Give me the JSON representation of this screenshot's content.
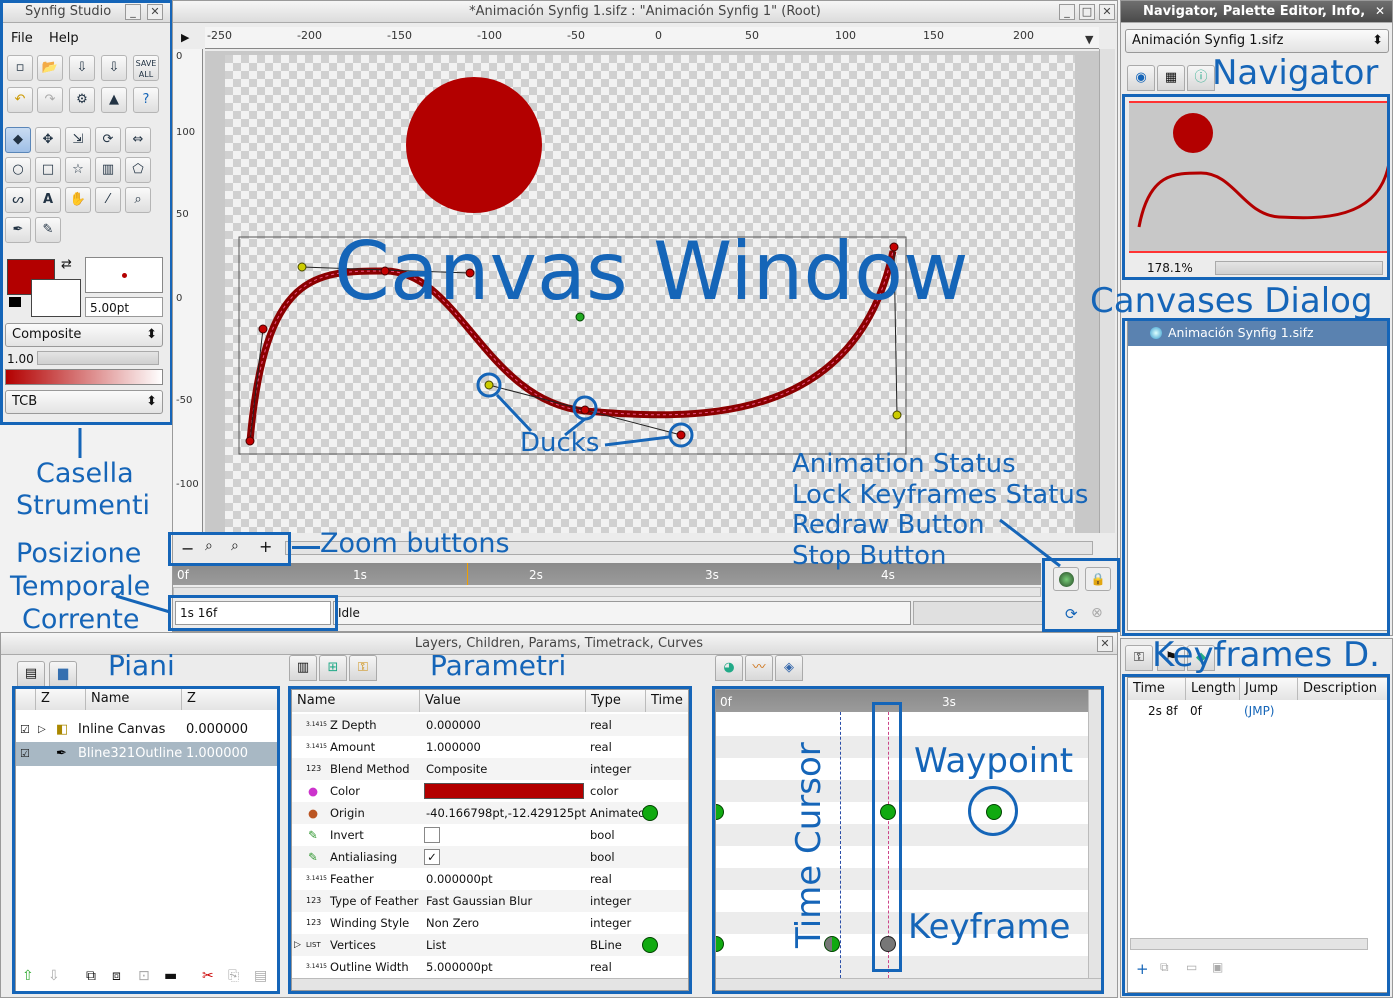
{
  "toolbox": {
    "title": "Synfig Studio",
    "menu": [
      "File",
      "Help"
    ],
    "outline_width": "5.00pt",
    "blend": "Composite",
    "opacity": "1.00",
    "interpolation": "TCB",
    "save_all": "SAVE ALL"
  },
  "canvas": {
    "title": "*Animación Synfig 1.sifz : \"Animación Synfig 1\" (Root)",
    "hruler": [
      "-250",
      "-200",
      "-150",
      "-100",
      "-50",
      "0",
      "50",
      "100",
      "150",
      "200"
    ],
    "vruler": [
      "0",
      "100",
      "50",
      "0",
      "-50",
      "-100"
    ],
    "timeline": [
      "0f",
      "1s",
      "2s",
      "3s",
      "4s"
    ],
    "current_time": "1s 16f",
    "status": "Idle"
  },
  "navigator": {
    "title": "Navigator, Palette Editor, Info,",
    "file": "Animación Synfig 1.sifz",
    "zoom": "178.1%"
  },
  "canvases": {
    "item": "Animación Synfig 1.sifz"
  },
  "keyframes": {
    "headers": [
      "Time",
      "Length",
      "Jump",
      "Description"
    ],
    "rows": [
      {
        "time": "2s 8f",
        "length": "0f",
        "jump": "(JMP)",
        "desc": ""
      }
    ]
  },
  "bottom": {
    "title": "Layers, Children, Params, Timetrack, Curves"
  },
  "layers": {
    "headers": [
      "Z",
      "Name",
      "Z"
    ],
    "rows": [
      {
        "name": "Inline Canvas",
        "z": "0.000000"
      },
      {
        "name": "Bline321Outline",
        "z": "1.000000"
      }
    ]
  },
  "params": {
    "headers": [
      "Name",
      "Value",
      "Type",
      "Time"
    ],
    "rows": [
      {
        "icon": "3.1415",
        "name": "Z Depth",
        "value": "0.000000",
        "type": "real"
      },
      {
        "icon": "3.1415",
        "name": "Amount",
        "value": "1.000000",
        "type": "real"
      },
      {
        "icon": "123",
        "name": "Blend Method",
        "value": "Composite",
        "type": "integer"
      },
      {
        "icon": "●",
        "name": "Color",
        "value": "",
        "type": "color"
      },
      {
        "icon": "●",
        "name": "Origin",
        "value": "-40.166798pt,-12.429125pt",
        "type": "Animated"
      },
      {
        "icon": "✎",
        "name": "Invert",
        "value": "",
        "type": "bool"
      },
      {
        "icon": "✎",
        "name": "Antialiasing",
        "value": "✓",
        "type": "bool"
      },
      {
        "icon": "3.1415",
        "name": "Feather",
        "value": "0.000000pt",
        "type": "real"
      },
      {
        "icon": "123",
        "name": "Type of Feather",
        "value": "Fast Gaussian Blur",
        "type": "integer"
      },
      {
        "icon": "123",
        "name": "Winding Style",
        "value": "Non Zero",
        "type": "integer"
      },
      {
        "icon": "LIST",
        "name": "Vertices",
        "value": "List",
        "type": "BLine"
      },
      {
        "icon": "3.1415",
        "name": "Outline Width",
        "value": "5.000000pt",
        "type": "real"
      }
    ]
  },
  "timetrack": {
    "labels": [
      "0f",
      "3s"
    ]
  },
  "annotations": {
    "canvas_window": "Canvas Window",
    "navigator": "Navigator",
    "canvases_dialog": "Canvases Dialog",
    "keyframes": "Keyframes D.",
    "toolbox": [
      "Casella",
      "Strumenti"
    ],
    "time": [
      "Posizione",
      "Temporale",
      "Corrente"
    ],
    "zoom": "Zoom buttons",
    "ducks": "Ducks",
    "anim": [
      "Animation Status",
      "Lock Keyframes Status",
      "Redraw Button",
      "Stop Button"
    ],
    "piani": "Piani",
    "parametri": "Parametri",
    "waypoint": "Waypoint",
    "time_cursor": "Time Cursor",
    "keyframe": "Keyframe"
  },
  "colors": {
    "accent": "#1565b8",
    "shape": "#b30000"
  }
}
